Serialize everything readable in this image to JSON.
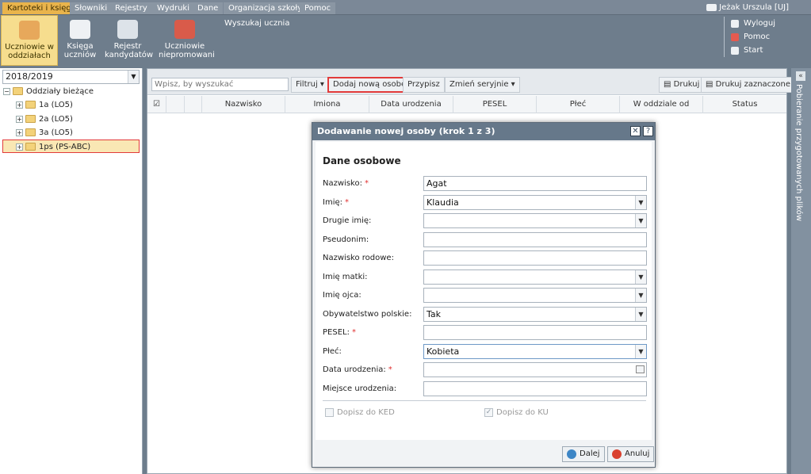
{
  "menu": {
    "items": [
      {
        "label": "Kartoteki i księgi",
        "active": true
      },
      {
        "label": "Słowniki"
      },
      {
        "label": "Rejestry"
      },
      {
        "label": "Wydruki"
      },
      {
        "label": "Dane"
      },
      {
        "label": "Organizacja szkoły"
      },
      {
        "label": "Pomoc"
      }
    ],
    "user": "Jeżak Urszula [UJ]"
  },
  "toolbar": {
    "buttons": [
      {
        "line1": "Uczniowie w",
        "line2": "oddziałach",
        "icon": "student-icon",
        "active": true
      },
      {
        "line1": "Księga",
        "line2": "uczniów",
        "icon": "book-icon"
      },
      {
        "line1": "Rejestr",
        "line2": "kandydatów",
        "icon": "register-icon"
      },
      {
        "line1": "Uczniowie",
        "line2": "niepromowani",
        "icon": "unpromoted-icon"
      }
    ],
    "search_student": "Wyszukaj ucznia",
    "right_links": [
      "Wyloguj",
      "Pomoc",
      "Start"
    ]
  },
  "left_panel": {
    "year": "2018/2019",
    "root": "Oddziały bieżące",
    "classes": [
      "1a (LO5)",
      "2a (LO5)",
      "3a (LO5)",
      "1ps (PS-ABC)"
    ]
  },
  "main": {
    "search_placeholder": "Wpisz, by wyszukać",
    "buttons": {
      "filter": "Filtruj",
      "add_person": "Dodaj nową osobę",
      "assign": "Przypisz",
      "change_serial": "Zmień seryjnie",
      "print": "Drukuj",
      "print_selected": "Drukuj zaznaczone"
    },
    "columns": [
      "Nazwisko",
      "Imiona",
      "Data urodzenia",
      "PESEL",
      "Płeć",
      "W oddziale od",
      "Status"
    ]
  },
  "side_strip": "Pobieranie przygotowanych plików",
  "dialog": {
    "title": "Dodawanie nowej osoby (krok 1 z 3)",
    "section": "Dane osobowe",
    "fields": [
      {
        "label": "Nazwisko:",
        "value": "Agat",
        "required": true,
        "type": "text"
      },
      {
        "label": "Imię:",
        "value": "Klaudia",
        "required": true,
        "type": "select"
      },
      {
        "label": "Drugie imię:",
        "value": "",
        "required": false,
        "type": "select"
      },
      {
        "label": "Pseudonim:",
        "value": "",
        "required": false,
        "type": "text"
      },
      {
        "label": "Nazwisko rodowe:",
        "value": "",
        "required": false,
        "type": "text"
      },
      {
        "label": "Imię matki:",
        "value": "",
        "required": false,
        "type": "select"
      },
      {
        "label": "Imię ojca:",
        "value": "",
        "required": false,
        "type": "select"
      },
      {
        "label": "Obywatelstwo polskie:",
        "value": "Tak",
        "required": false,
        "type": "select"
      },
      {
        "label": "PESEL:",
        "value": "",
        "required": true,
        "type": "text"
      },
      {
        "label": "Płeć:",
        "value": "Kobieta",
        "required": false,
        "type": "select"
      },
      {
        "label": "Data urodzenia:",
        "value": "",
        "required": true,
        "type": "date"
      },
      {
        "label": "Miejsce urodzenia:",
        "value": "",
        "required": false,
        "type": "text"
      }
    ],
    "checkbox_ked": "Dopisz do KED",
    "checkbox_ku": "Dopisz do KU",
    "next": "Dalej",
    "cancel": "Anuluj"
  }
}
